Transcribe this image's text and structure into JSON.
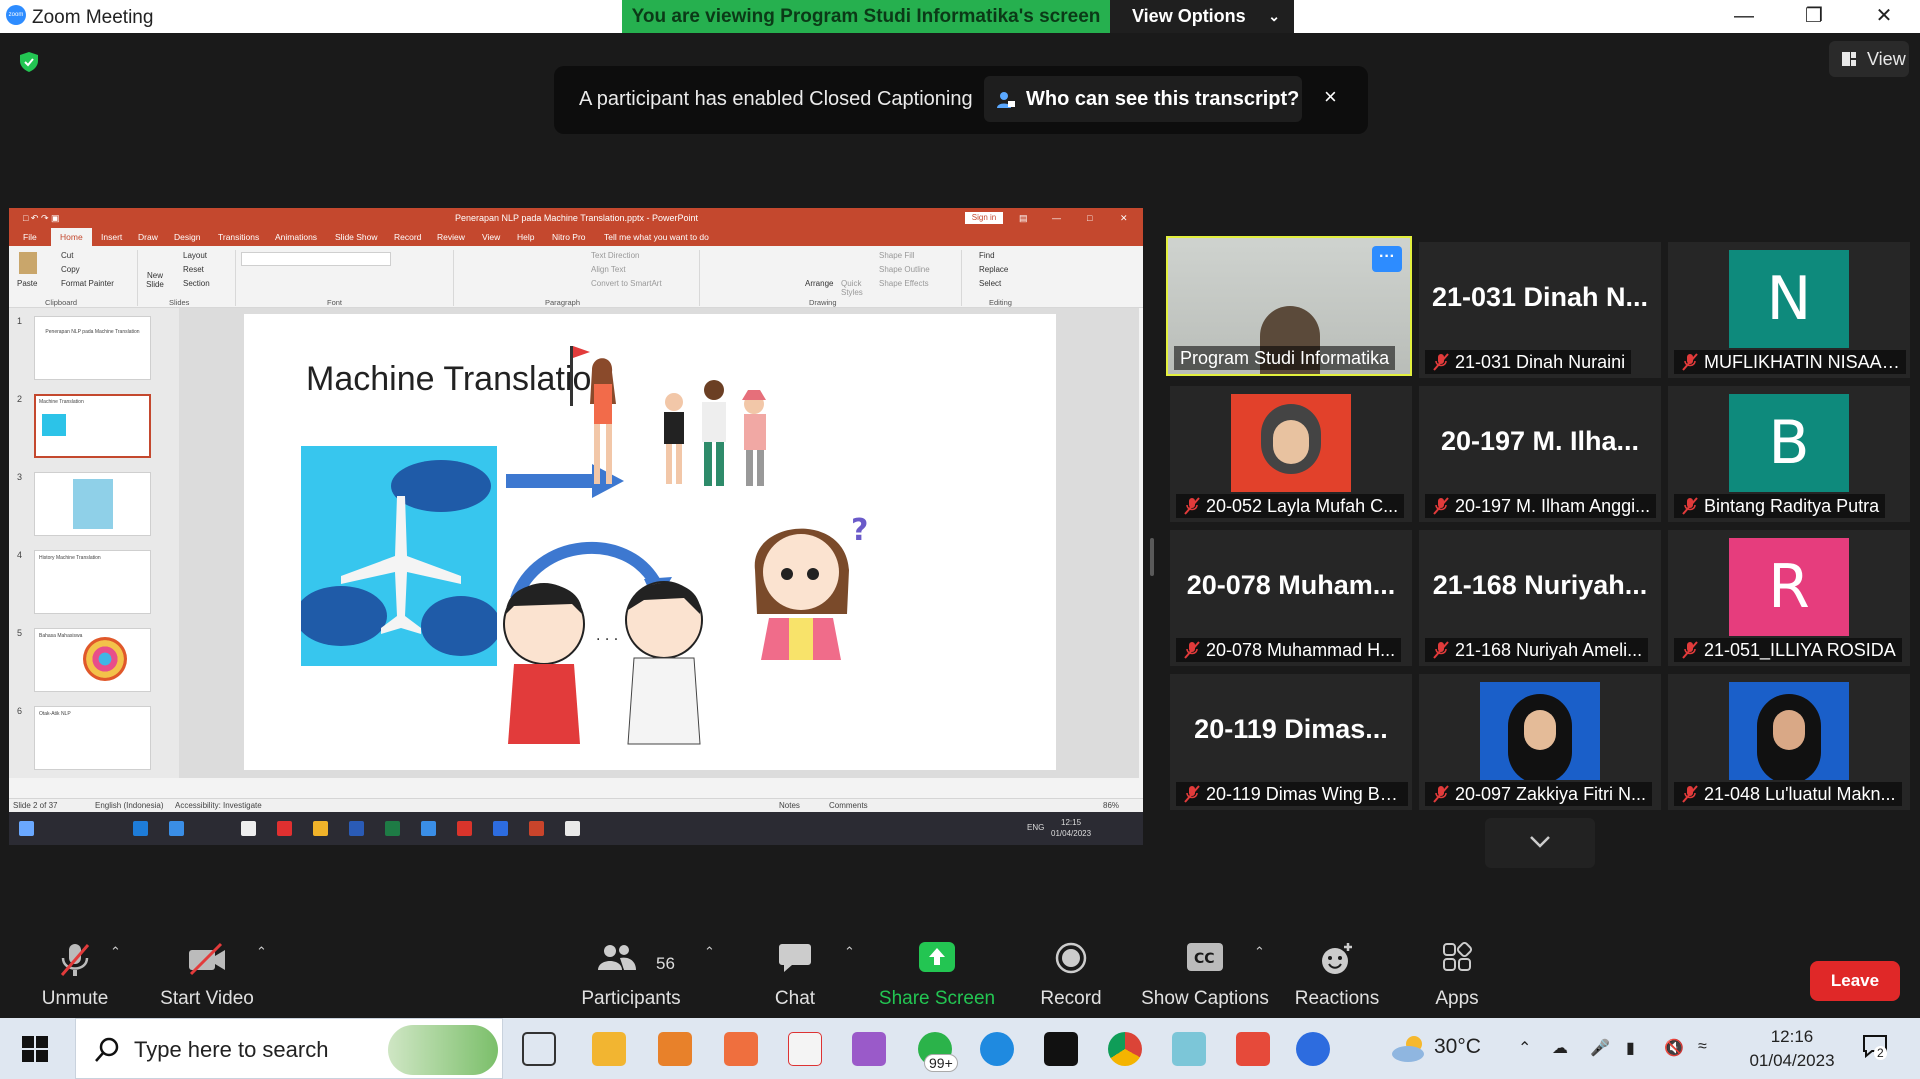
{
  "window": {
    "title": "Zoom Meeting",
    "app_icon": "zoom",
    "share_banner": "You are viewing Program Studi Informatika's screen",
    "view_options": "View Options"
  },
  "stage": {
    "view_label": "View",
    "cc_toast": {
      "message": "A participant has enabled Closed Captioning",
      "who_button": "Who can see this transcript?",
      "close": "×"
    }
  },
  "powerpoint": {
    "doc_title": "Penerapan NLP pada Machine Translation.pptx - PowerPoint",
    "sign_in": "Sign in",
    "tabs": [
      "File",
      "Home",
      "Insert",
      "Draw",
      "Design",
      "Transitions",
      "Animations",
      "Slide Show",
      "Record",
      "Review",
      "View",
      "Help",
      "Nitro Pro",
      "Tell me what you want to do"
    ],
    "ribbon": {
      "clipboard": {
        "paste": "Paste",
        "cut": "Cut",
        "copy": "Copy",
        "format_painter": "Format Painter",
        "group": "Clipboard"
      },
      "slides": {
        "new_slide": "New Slide",
        "layout": "Layout",
        "reset": "Reset",
        "section": "Section",
        "group": "Slides"
      },
      "font_group": "Font",
      "paragraph": {
        "text_direction": "Text Direction",
        "align_text": "Align Text",
        "smartart": "Convert to SmartArt",
        "group": "Paragraph"
      },
      "drawing": {
        "arrange": "Arrange",
        "quick_styles": "Quick Styles",
        "shape_fill": "Shape Fill",
        "shape_outline": "Shape Outline",
        "shape_effects": "Shape Effects",
        "group": "Drawing"
      },
      "editing": {
        "find": "Find",
        "replace": "Replace",
        "select": "Select",
        "group": "Editing"
      }
    },
    "thumbnails": [
      {
        "num": "1",
        "text": "Penerapan NLP pada Machine Translation"
      },
      {
        "num": "2",
        "text": "Machine Translation"
      },
      {
        "num": "3",
        "text": ""
      },
      {
        "num": "4",
        "text": "History Machine Translation"
      },
      {
        "num": "5",
        "text": "Bahasa Mahasiswa"
      },
      {
        "num": "6",
        "text": "Otak-Atik NLP"
      }
    ],
    "slide_title": "Machine Translation",
    "status": {
      "slide": "Slide 2 of 37",
      "language": "English (Indonesia)",
      "accessibility": "Accessibility: Investigate",
      "notes": "Notes",
      "comments": "Comments",
      "zoom": "86%"
    },
    "taskbar": {
      "lang": "ENG",
      "time": "12:15",
      "date": "01/04/2023"
    }
  },
  "participants": [
    {
      "tile": "Program Studi Informatika",
      "label": "Program Studi Informatika",
      "kind": "video",
      "active": true,
      "muted": false
    },
    {
      "tile": "21-031  Dinah  N...",
      "label": "21-031 Dinah Nuraini",
      "kind": "name",
      "muted": true
    },
    {
      "tile": "N",
      "label": "MUFLIKHATIN NISAAD...",
      "kind": "letter",
      "color": "#0e8a7c",
      "muted": true
    },
    {
      "tile": "",
      "label": "20-052 Layla Mufah C...",
      "kind": "photo",
      "color": "#e2412b",
      "muted": true
    },
    {
      "tile": "20-197  M.  Ilha...",
      "label": "20-197 M. Ilham Anggi...",
      "kind": "name",
      "muted": true
    },
    {
      "tile": "B",
      "label": "Bintang Raditya Putra",
      "kind": "letter",
      "color": "#0e8a7c",
      "muted": true
    },
    {
      "tile": "20-078  Muham...",
      "label": "20-078 Muhammad H...",
      "kind": "name",
      "muted": true
    },
    {
      "tile": "21-168  Nuriyah...",
      "label": "21-168 Nuriyah Ameli...",
      "kind": "name",
      "muted": true
    },
    {
      "tile": "R",
      "label": "21-051_ILLIYA ROSIDA",
      "kind": "letter",
      "color": "#e63d7d",
      "muted": true
    },
    {
      "tile": "20-119  Dimas...",
      "label": "20-119 Dimas Wing Ba...",
      "kind": "name",
      "muted": true
    },
    {
      "tile": "",
      "label": "20-097 Zakkiya Fitri N...",
      "kind": "photo",
      "color": "#1a5fc9",
      "muted": true
    },
    {
      "tile": "",
      "label": "21-048 Lu'luatul Makn...",
      "kind": "photo",
      "color": "#1a5fc9",
      "muted": true
    }
  ],
  "toolbar": {
    "unmute": "Unmute",
    "start_video": "Start Video",
    "participants": "Participants",
    "participants_count": "56",
    "chat": "Chat",
    "share_screen": "Share Screen",
    "record": "Record",
    "show_captions": "Show Captions",
    "reactions": "Reactions",
    "apps": "Apps",
    "leave": "Leave"
  },
  "windows_taskbar": {
    "search_placeholder": "Type here to search",
    "badge": "99+",
    "weather": "30°C",
    "time": "12:16",
    "date": "01/04/2023",
    "notifications": "2"
  }
}
